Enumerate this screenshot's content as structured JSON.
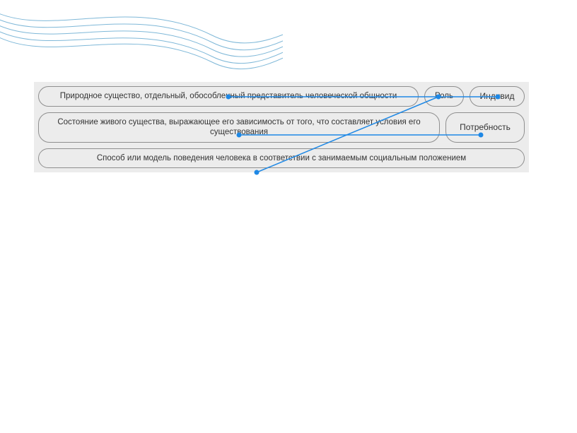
{
  "definitions": {
    "d1": "Природное существо, отдельный, обособленный представитель человеческой общности",
    "d2": "Состояние живого существа, выражающее его зависимость от того, что составляет условия его существования",
    "d3": "Способ или модель поведения человека в соответствии с занимаемым социальным положением"
  },
  "terms": {
    "t1": "Роль",
    "t2": "Индивид",
    "t3": "Потребность"
  },
  "matches": [
    {
      "from_def": "d1",
      "to_term": "t2"
    },
    {
      "from_def": "d2",
      "to_term": "t3"
    },
    {
      "from_def": "d3",
      "to_term": "t1"
    }
  ]
}
